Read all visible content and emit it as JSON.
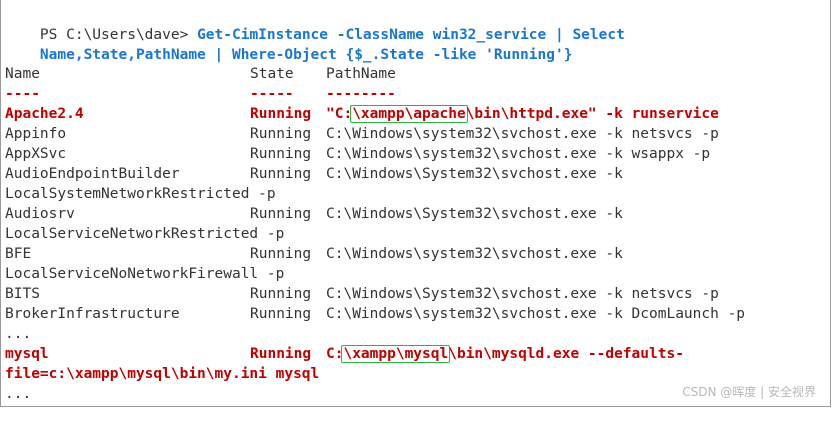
{
  "command": {
    "prompt": "PS C:\\Users\\dave> ",
    "line1": "Get-CimInstance -ClassName win32_service | Select",
    "line2": "Name,State,PathName | Where-Object {$_.State -like 'Running'}"
  },
  "table": {
    "headers": {
      "name": "Name",
      "state": "State",
      "path": "PathName"
    },
    "underlines": {
      "name": "----",
      "state": "-----",
      "path": "--------"
    }
  },
  "rows": {
    "apache": {
      "name": "Apache2.4",
      "state": "Running",
      "path_pre": "\"C:",
      "path_hl": "\\xampp\\apache",
      "path_post": "\\bin\\httpd.exe\" -k runservice"
    },
    "appinfo": {
      "name": "Appinfo",
      "state": "Running",
      "path": "C:\\Windows\\system32\\svchost.exe -k netsvcs -p"
    },
    "appxsvc": {
      "name": "AppXSvc",
      "state": "Running",
      "path": "C:\\Windows\\system32\\svchost.exe -k wsappx -p"
    },
    "audioendpoint": {
      "name": "AudioEndpointBuilder",
      "state": "Running",
      "path": "C:\\Windows\\System32\\svchost.exe -k",
      "wrap": "LocalSystemNetworkRestricted -p"
    },
    "audiosrv": {
      "name": "Audiosrv",
      "state": "Running",
      "path": "C:\\Windows\\System32\\svchost.exe -k",
      "wrap": "LocalServiceNetworkRestricted -p"
    },
    "bfe": {
      "name": "BFE",
      "state": "Running",
      "path": "C:\\Windows\\system32\\svchost.exe -k",
      "wrap": "LocalServiceNoNetworkFirewall -p"
    },
    "bits": {
      "name": "BITS",
      "state": "Running",
      "path": "C:\\Windows\\System32\\svchost.exe -k netsvcs -p"
    },
    "broker": {
      "name": "BrokerInfrastructure",
      "state": "Running",
      "path": "C:\\Windows\\system32\\svchost.exe -k DcomLaunch -p"
    },
    "mysql": {
      "name": "mysql",
      "state": "Running",
      "path_pre": "C:",
      "path_hl": "\\xampp\\mysql",
      "path_post": "\\bin\\mysqld.exe --defaults-",
      "wrap": "file=c:\\xampp\\mysql\\bin\\my.ini mysql"
    }
  },
  "ellipsis": "...",
  "watermark": "CSDN @晖度 | 安全视界",
  "colors": {
    "command": "#1976d2",
    "highlight_row": "#c00000",
    "box": "#2fb33f",
    "text": "#333333"
  }
}
